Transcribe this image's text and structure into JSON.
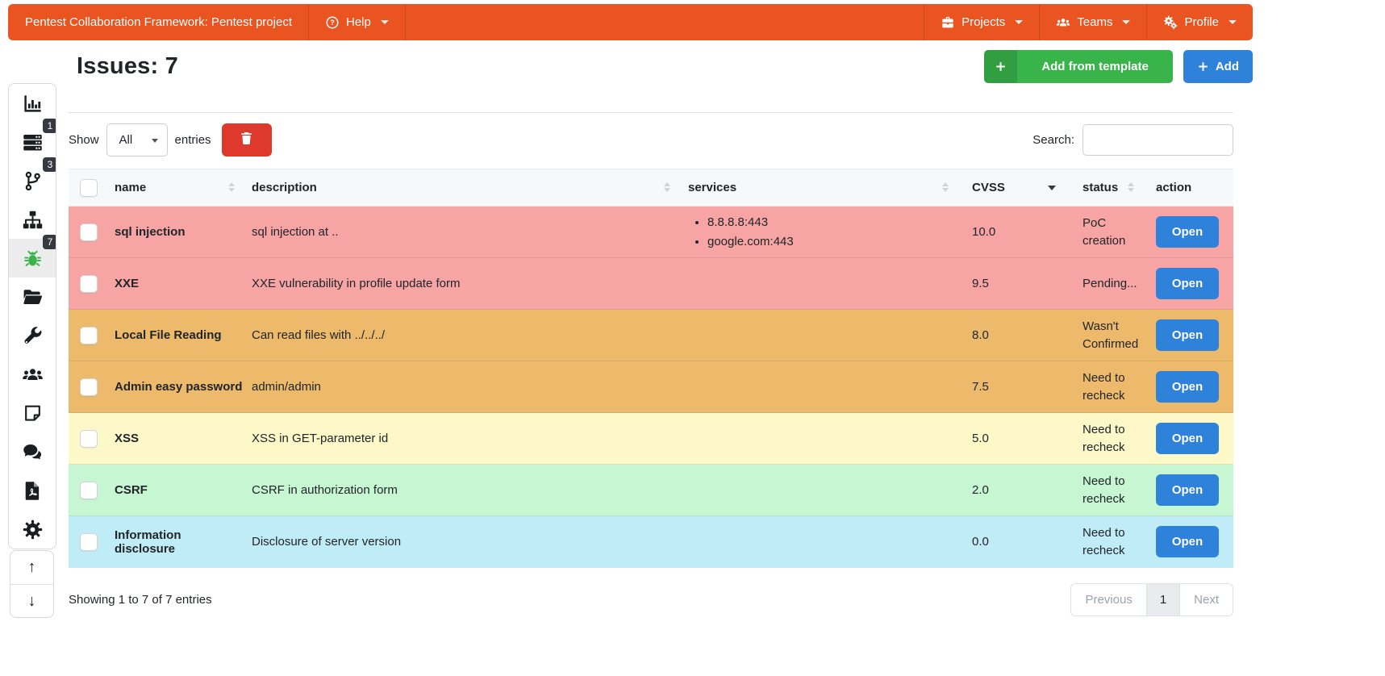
{
  "navbar": {
    "brand": "Pentest Collaboration Framework: Pentest project",
    "help_label": "Help",
    "right_items": [
      {
        "icon": "briefcase-icon",
        "label": "Projects"
      },
      {
        "icon": "team-icon",
        "label": "Teams"
      },
      {
        "icon": "gears-icon",
        "label": "Profile"
      }
    ]
  },
  "page": {
    "title": "Issues: 7"
  },
  "actions": {
    "add_from_template": "Add from template",
    "add": "Add"
  },
  "sidebar": {
    "items": [
      {
        "icon": "chart-bar-icon",
        "badge": ""
      },
      {
        "icon": "hosts-icon",
        "badge": "1"
      },
      {
        "icon": "code-branch-icon",
        "badge": "3"
      },
      {
        "icon": "sitemap-icon",
        "badge": ""
      },
      {
        "icon": "bug-icon",
        "badge": "7",
        "active": true
      },
      {
        "icon": "folder-open-icon",
        "badge": ""
      },
      {
        "icon": "wrench-icon",
        "badge": ""
      },
      {
        "icon": "users-icon",
        "badge": ""
      },
      {
        "icon": "sticky-note-icon",
        "badge": ""
      },
      {
        "icon": "comments-icon",
        "badge": ""
      },
      {
        "icon": "file-pdf-icon",
        "badge": ""
      },
      {
        "icon": "gear-icon",
        "badge": ""
      }
    ],
    "scroll_up": "↑",
    "scroll_down": "↓"
  },
  "controls": {
    "show_label": "Show",
    "page_size_value": "All",
    "entries_label": "entries",
    "search_label": "Search:",
    "search_value": "",
    "search_placeholder": ""
  },
  "table": {
    "headers": [
      "name",
      "description",
      "services",
      "CVSS",
      "status",
      "action"
    ],
    "open_label": "Open",
    "rows": [
      {
        "name": "sql injection",
        "description": "sql injection at ..",
        "services": [
          "8.8.8.8:443",
          "google.com:443"
        ],
        "cvss": "10.0",
        "status": "PoC creation",
        "severity": "critical"
      },
      {
        "name": "XXE",
        "description": "XXE vulnerability in profile update form",
        "services": [],
        "cvss": "9.5",
        "status": "Pending...",
        "severity": "critical"
      },
      {
        "name": "Local File Reading",
        "description": "Can read files with  ../../../",
        "services": [],
        "cvss": "8.0",
        "status": "Wasn't Confirmed",
        "severity": "high"
      },
      {
        "name": "Admin easy password",
        "description": "admin/admin",
        "services": [],
        "cvss": "7.5",
        "status": "Need to recheck",
        "severity": "high"
      },
      {
        "name": "XSS",
        "description": "XSS in GET-parameter id",
        "services": [],
        "cvss": "5.0",
        "status": "Need to recheck",
        "severity": "medium"
      },
      {
        "name": "CSRF",
        "description": "CSRF in authorization form",
        "services": [],
        "cvss": "2.0",
        "status": "Need to recheck",
        "severity": "low"
      },
      {
        "name": "Information disclosure",
        "description": "Disclosure of server version",
        "services": [],
        "cvss": "0.0",
        "status": "Need to recheck",
        "severity": "info"
      }
    ]
  },
  "footer": {
    "showing": "Showing 1 to 7 of 7 entries",
    "pagination": {
      "previous": "Previous",
      "current": "1",
      "next": "Next"
    }
  },
  "colors": {
    "navbar": "#e95420",
    "success": "#38b44a",
    "danger": "#df382c",
    "primary": "#2e82d9",
    "sev_critical": "#f7a4a4",
    "sev_high": "#ecba6a",
    "sev_medium": "#fcf8c8",
    "sev_low": "#c6f6d2",
    "sev_info": "#c0ecf8"
  }
}
